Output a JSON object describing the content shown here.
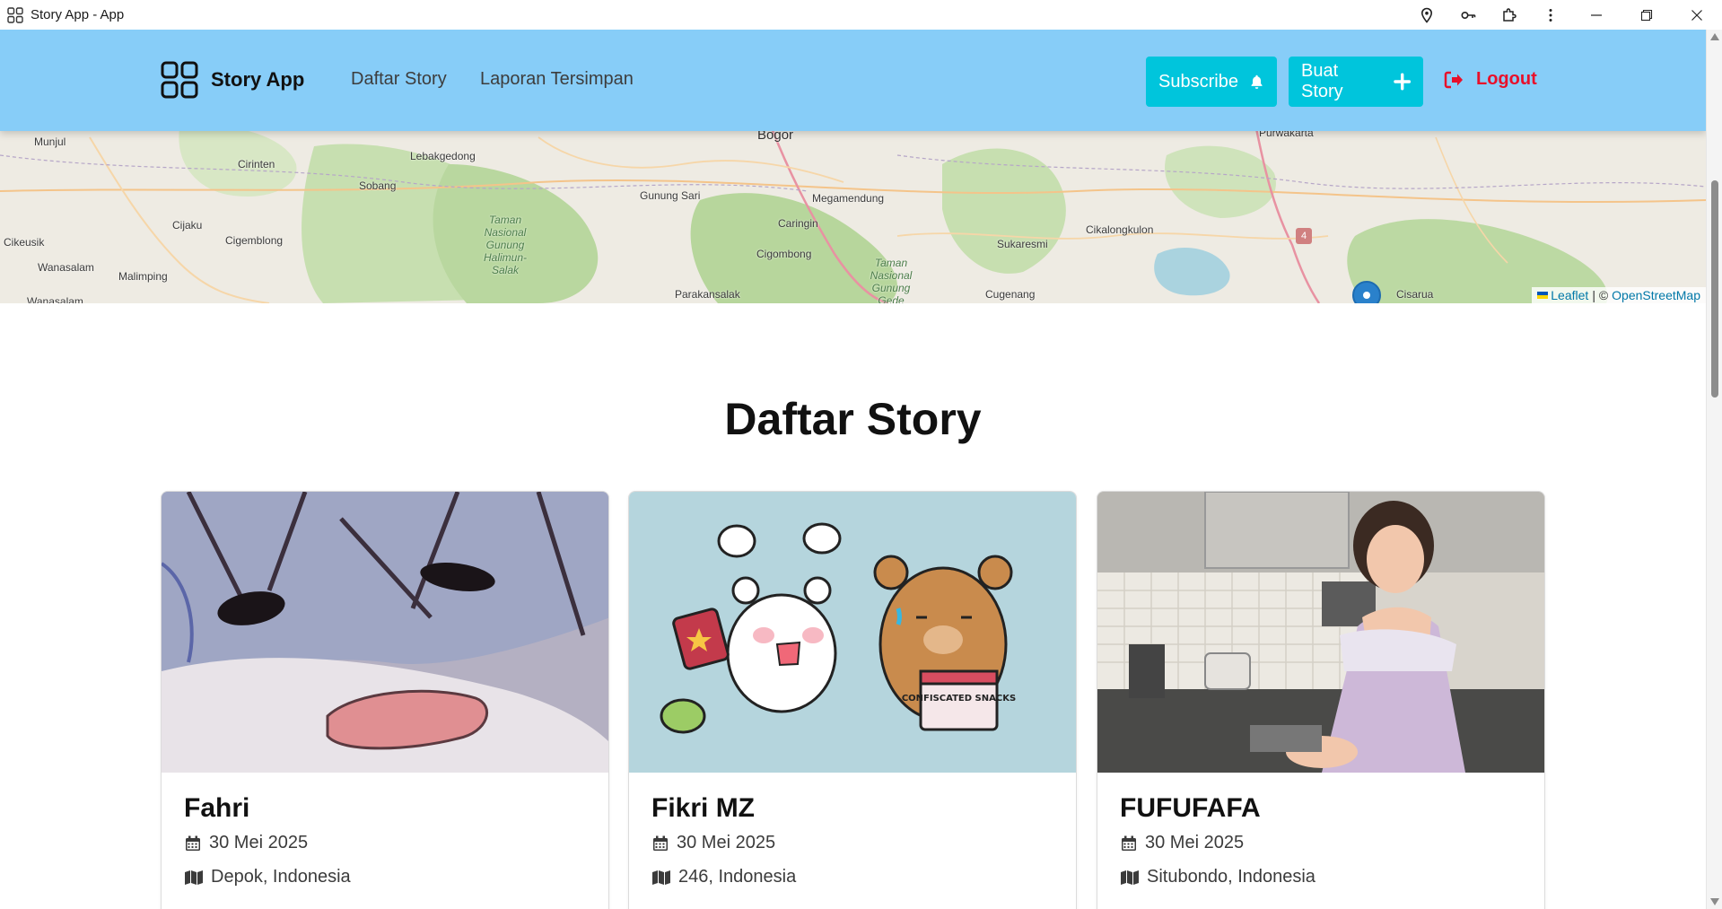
{
  "window": {
    "title": "Story App - App"
  },
  "header": {
    "brand": "Story App",
    "nav": [
      "Daftar Story",
      "Laporan Tersimpan"
    ],
    "subscribe_label": "Subscribe",
    "create_label": "Buat Story",
    "logout_label": "Logout"
  },
  "map": {
    "labels": [
      "Munjul",
      "Bogor",
      "Cirinten",
      "Lebakgedong",
      "Sobang",
      "Gunung Sari",
      "Megamendung",
      "Caringin",
      "Cijaku",
      "Cigemblong",
      "Cikeusik",
      "Wanasalam",
      "Malimping",
      "Cigombong",
      "Sukaresmi",
      "Cikalongkulon",
      "Parakansalak",
      "Cugenang",
      "Cisarua",
      "Purwakarta",
      "Wanasalam"
    ],
    "park_labels": [
      "Taman Nasional Gunung Halimun-Salak",
      "Taman Nasional Gunung Gede Pangrango"
    ],
    "road_badge": "4",
    "attribution_leaflet": "Leaflet",
    "attribution_separator": "| ©",
    "attribution_osm": "OpenStreetMap"
  },
  "page_title": "Daftar Story",
  "stories": [
    {
      "name": "Fahri",
      "date": "30 Mei 2025",
      "location": "Depok, Indonesia"
    },
    {
      "name": "Fikri MZ",
      "date": "30 Mei 2025",
      "location": "246, Indonesia"
    },
    {
      "name": "FUFUFAFA",
      "date": "30 Mei 2025",
      "location": "Situbondo, Indonesia"
    }
  ],
  "colors": {
    "header_bg": "#87cdf8",
    "button_bg": "#00c5dc",
    "logout": "#e8102a"
  },
  "illustration": {
    "sign_text": "CONFISCATED SNACKS"
  }
}
